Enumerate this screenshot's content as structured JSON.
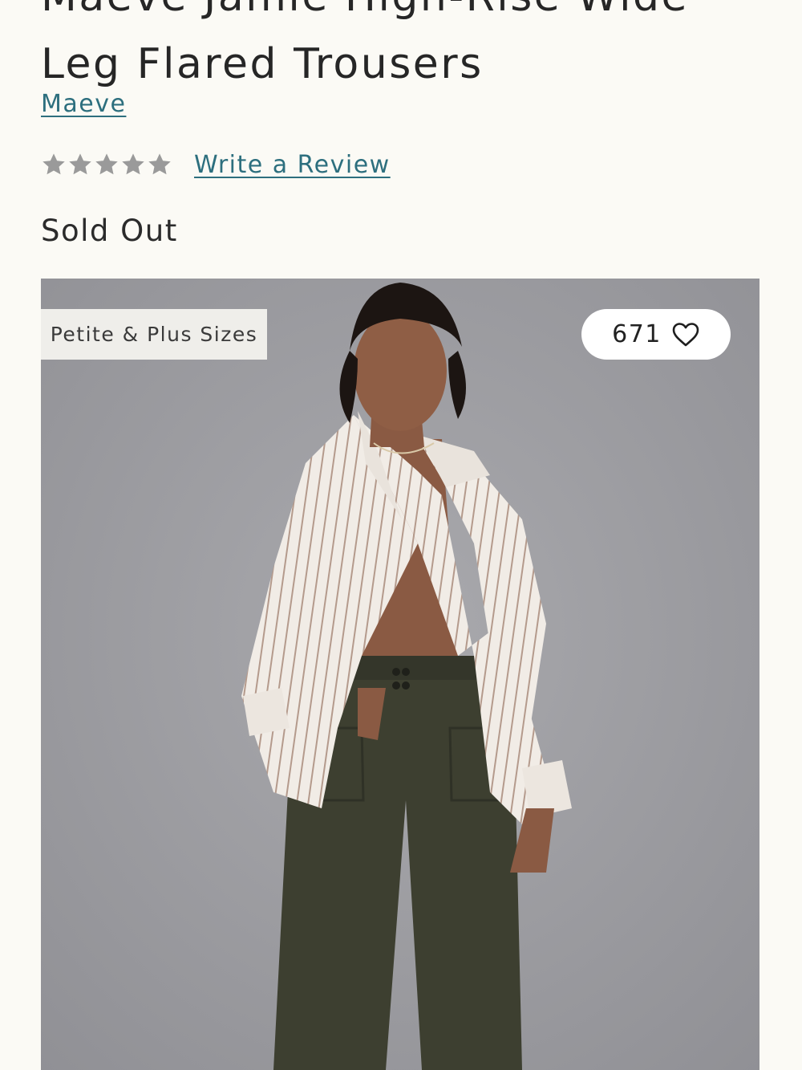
{
  "product": {
    "title_line_1": "Maeve Jamie High-Rise Wide",
    "title_line_2": "Leg Flared Trousers",
    "brand": "Maeve",
    "rating": {
      "stars_filled": 0,
      "stars_total": 5,
      "star_color": "#9a9a9a",
      "write_review_label": "Write a Review"
    },
    "stock_status": "Sold Out"
  },
  "image": {
    "badge_label": "Petite & Plus Sizes",
    "favorite_count": "671",
    "favorite_icon": "heart-outline-icon"
  },
  "colors": {
    "link": "#2d6f7e",
    "background": "#fbfaf5",
    "text": "#2b2b2b"
  }
}
